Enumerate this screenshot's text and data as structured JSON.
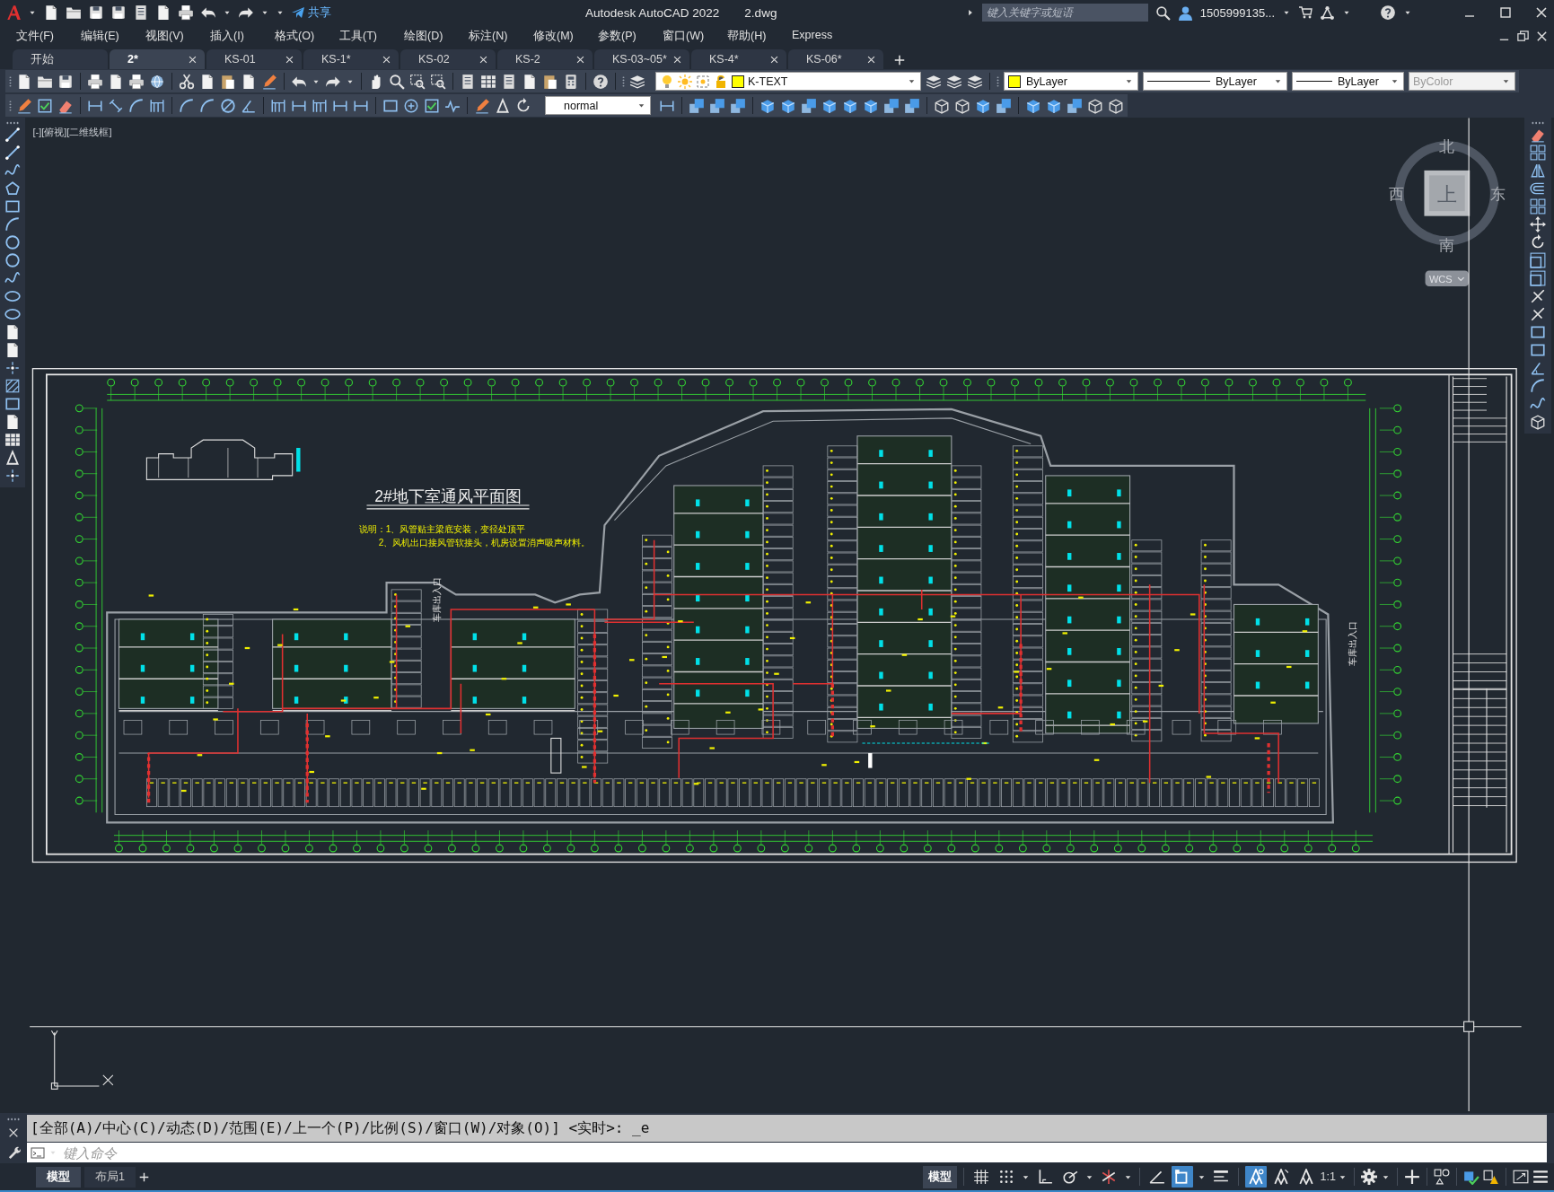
{
  "title_bar": {
    "share": "共享",
    "app_title": "Autodesk AutoCAD 2022",
    "filename": "2.dwg",
    "search": {
      "placeholder": "键入关键字或短语"
    },
    "user": "1505999135..."
  },
  "menu": [
    "文件(F)",
    "编辑(E)",
    "视图(V)",
    "插入(I)",
    "格式(O)",
    "工具(T)",
    "绘图(D)",
    "标注(N)",
    "修改(M)",
    "参数(P)",
    "窗口(W)",
    "帮助(H)",
    "Express"
  ],
  "file_tabs": [
    {
      "label": "开始",
      "selected": false,
      "closable": false
    },
    {
      "label": "2*",
      "selected": true,
      "closable": true
    },
    {
      "label": "KS-01",
      "selected": false,
      "closable": true
    },
    {
      "label": "KS-1*",
      "selected": false,
      "closable": true
    },
    {
      "label": "KS-02",
      "selected": false,
      "closable": true
    },
    {
      "label": "KS-2",
      "selected": false,
      "closable": true
    },
    {
      "label": "KS-03~05*",
      "selected": false,
      "closable": true
    },
    {
      "label": "KS-4*",
      "selected": false,
      "closable": true
    },
    {
      "label": "KS-06*",
      "selected": false,
      "closable": true
    }
  ],
  "properties": {
    "layer": "K-TEXT",
    "color_setting": "ByLayer",
    "linetype": "ByLayer",
    "lineweight": "ByLayer",
    "plot_style": {
      "value": "ByColor",
      "disabled": true
    }
  },
  "text_style": "normal",
  "viewport": {
    "label": "[-][俯视][二维线框]",
    "viewcube": {
      "north": "北",
      "south": "南",
      "west": "西",
      "east": "东",
      "face": "上",
      "ucs": "WCS"
    }
  },
  "drawing": {
    "title": "2#地下室通风平面图",
    "notes": [
      "说明：1、风管贴主梁底安装，变径处顶平",
      "2、风机出口接风管软接头，机房设置消声吸声材料。"
    ],
    "entrance_labels": [
      "车库出入口",
      "车库出入口"
    ]
  },
  "command": {
    "history": "[全部(A)/中心(C)/动态(D)/范围(E)/上一个(P)/比例(S)/窗口(W)/对象(O)] <实时>: _e",
    "placeholder": "键入命令"
  },
  "layout_tabs": [
    {
      "label": "模型",
      "selected": true
    },
    {
      "label": "布局1",
      "selected": false
    }
  ],
  "status_bar": {
    "space": "模型",
    "scale": "1:1",
    "toggles": [
      {
        "kind": "grid",
        "on": false
      },
      {
        "kind": "snap",
        "on": false
      },
      {
        "kind": "ortho",
        "on": false
      },
      {
        "kind": "polar",
        "on": false
      },
      {
        "kind": "isodraft",
        "on": false
      },
      {
        "kind": "dynamic-angle",
        "on": false
      },
      {
        "kind": "osnap",
        "on": true
      },
      {
        "kind": "lineweight",
        "on": false
      },
      {
        "kind": "annotation-visibility",
        "on": true
      },
      {
        "kind": "autoscale",
        "on": false
      },
      {
        "kind": "annotation-scale",
        "on": false
      }
    ]
  }
}
